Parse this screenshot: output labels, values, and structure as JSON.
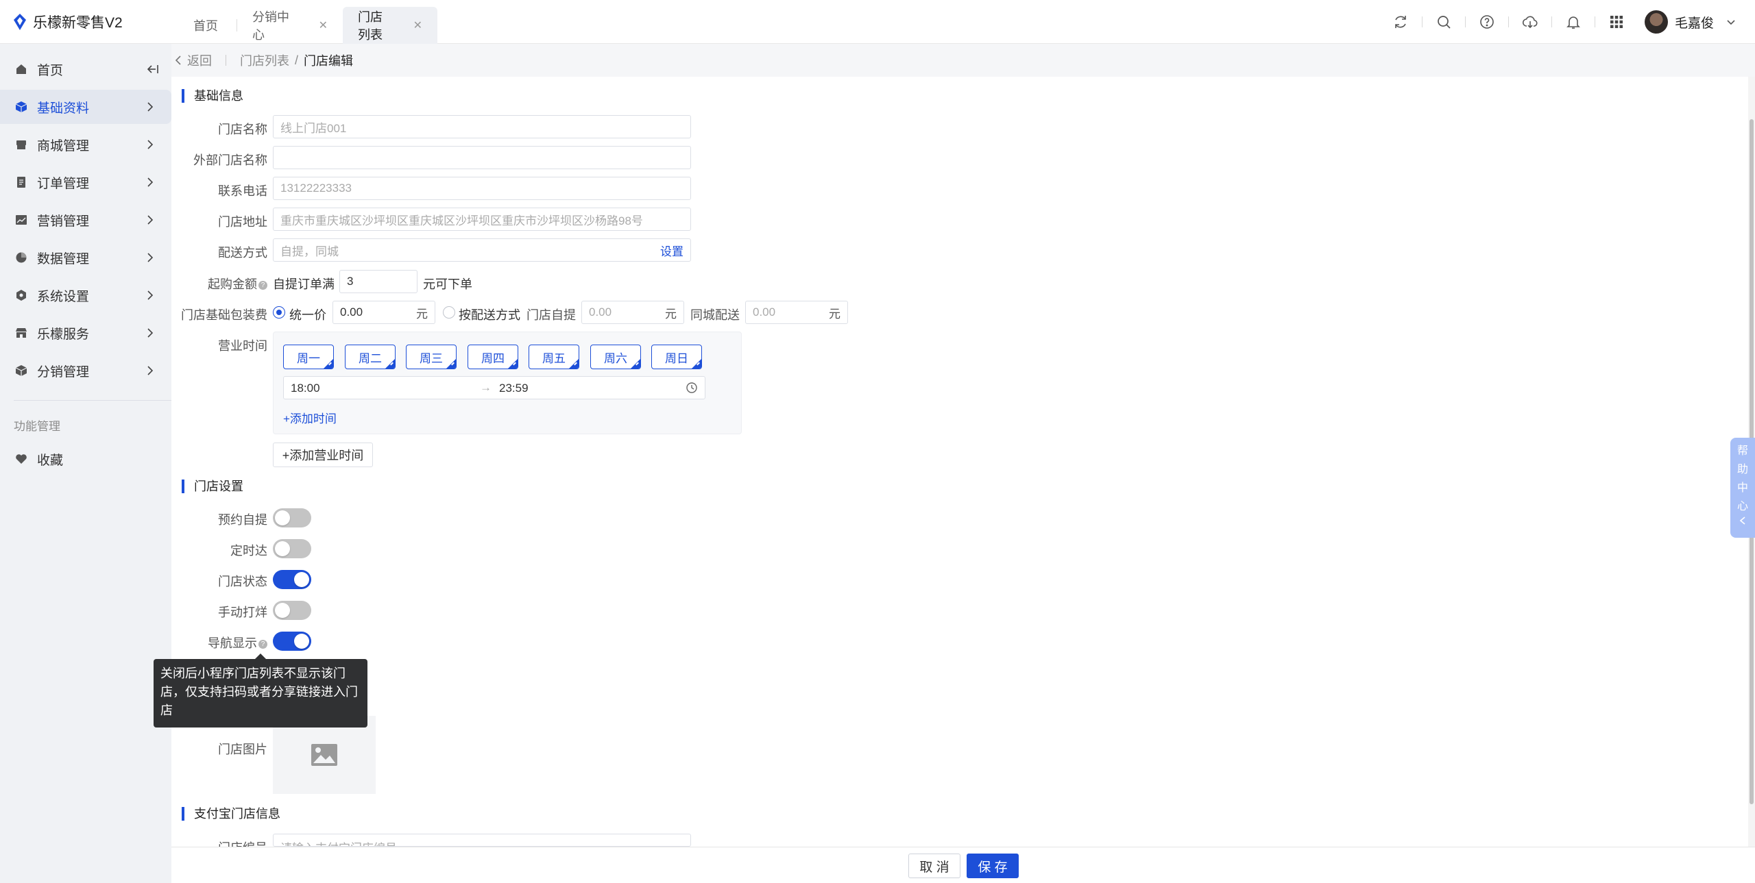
{
  "app": {
    "title": "乐檬新零售V2"
  },
  "tabs": [
    {
      "label": "首页"
    },
    {
      "label": "分销中心"
    },
    {
      "label": "门店列表"
    }
  ],
  "user": {
    "name": "毛嘉俊"
  },
  "sidebar": {
    "items": [
      {
        "label": "首页"
      },
      {
        "label": "基础资料"
      },
      {
        "label": "商城管理"
      },
      {
        "label": "订单管理"
      },
      {
        "label": "营销管理"
      },
      {
        "label": "数据管理"
      },
      {
        "label": "系统设置"
      },
      {
        "label": "乐檬服务"
      },
      {
        "label": "分销管理"
      }
    ],
    "group_label": "功能管理",
    "favorites_label": "收藏"
  },
  "breadcrumb": {
    "back": "返回",
    "parent": "门店列表",
    "separator": "/",
    "current": "门店编辑"
  },
  "basic": {
    "title": "基础信息",
    "store_name": {
      "label": "门店名称",
      "placeholder": "线上门店001"
    },
    "external_name": {
      "label": "外部门店名称",
      "value": ""
    },
    "phone": {
      "label": "联系电话",
      "placeholder": "13122223333"
    },
    "address": {
      "label": "门店地址",
      "placeholder": "重庆市重庆城区沙坪坝区重庆城区沙坪坝区重庆市沙坪坝区沙杨路98号"
    },
    "delivery": {
      "label": "配送方式",
      "value": "自提，同城",
      "action": "设置"
    },
    "min_order": {
      "label": "起购金额",
      "prefix": "自提订单满",
      "value": "3",
      "suffix": "元可下单"
    },
    "packaging": {
      "label": "门店基础包装费",
      "option_unified": "统一价",
      "unified_value": "0.00",
      "unit": "元",
      "option_by_delivery": "按配送方式",
      "pickup_label": "门店自提",
      "pickup_value": "0.00",
      "city_label": "同城配送",
      "city_value": "0.00"
    },
    "hours": {
      "label": "营业时间",
      "days": [
        "周一",
        "周二",
        "周三",
        "周四",
        "周五",
        "周六",
        "周日"
      ],
      "start": "18:00",
      "end": "23:59",
      "add_time": "+添加时间",
      "add_hours": "+添加营业时间"
    }
  },
  "settings": {
    "title": "门店设置",
    "toggles": [
      {
        "label": "预约自提",
        "on": false
      },
      {
        "label": "定时达",
        "on": false
      },
      {
        "label": "门店状态",
        "on": true
      },
      {
        "label": "手动打烊",
        "on": false
      },
      {
        "label": "导航显示",
        "on": true
      }
    ],
    "image_label": "门店图片",
    "tooltip": "关闭后小程序门店列表不显示该门店，仅支持扫码或者分享链接进入门店"
  },
  "alipay": {
    "title": "支付宝门店信息",
    "store_no": {
      "label": "门店编号",
      "placeholder": "请输入支付宝门店编号"
    }
  },
  "footer": {
    "cancel": "取 消",
    "save": "保 存"
  },
  "help": {
    "chars": [
      "帮",
      "助",
      "中",
      "心"
    ]
  }
}
